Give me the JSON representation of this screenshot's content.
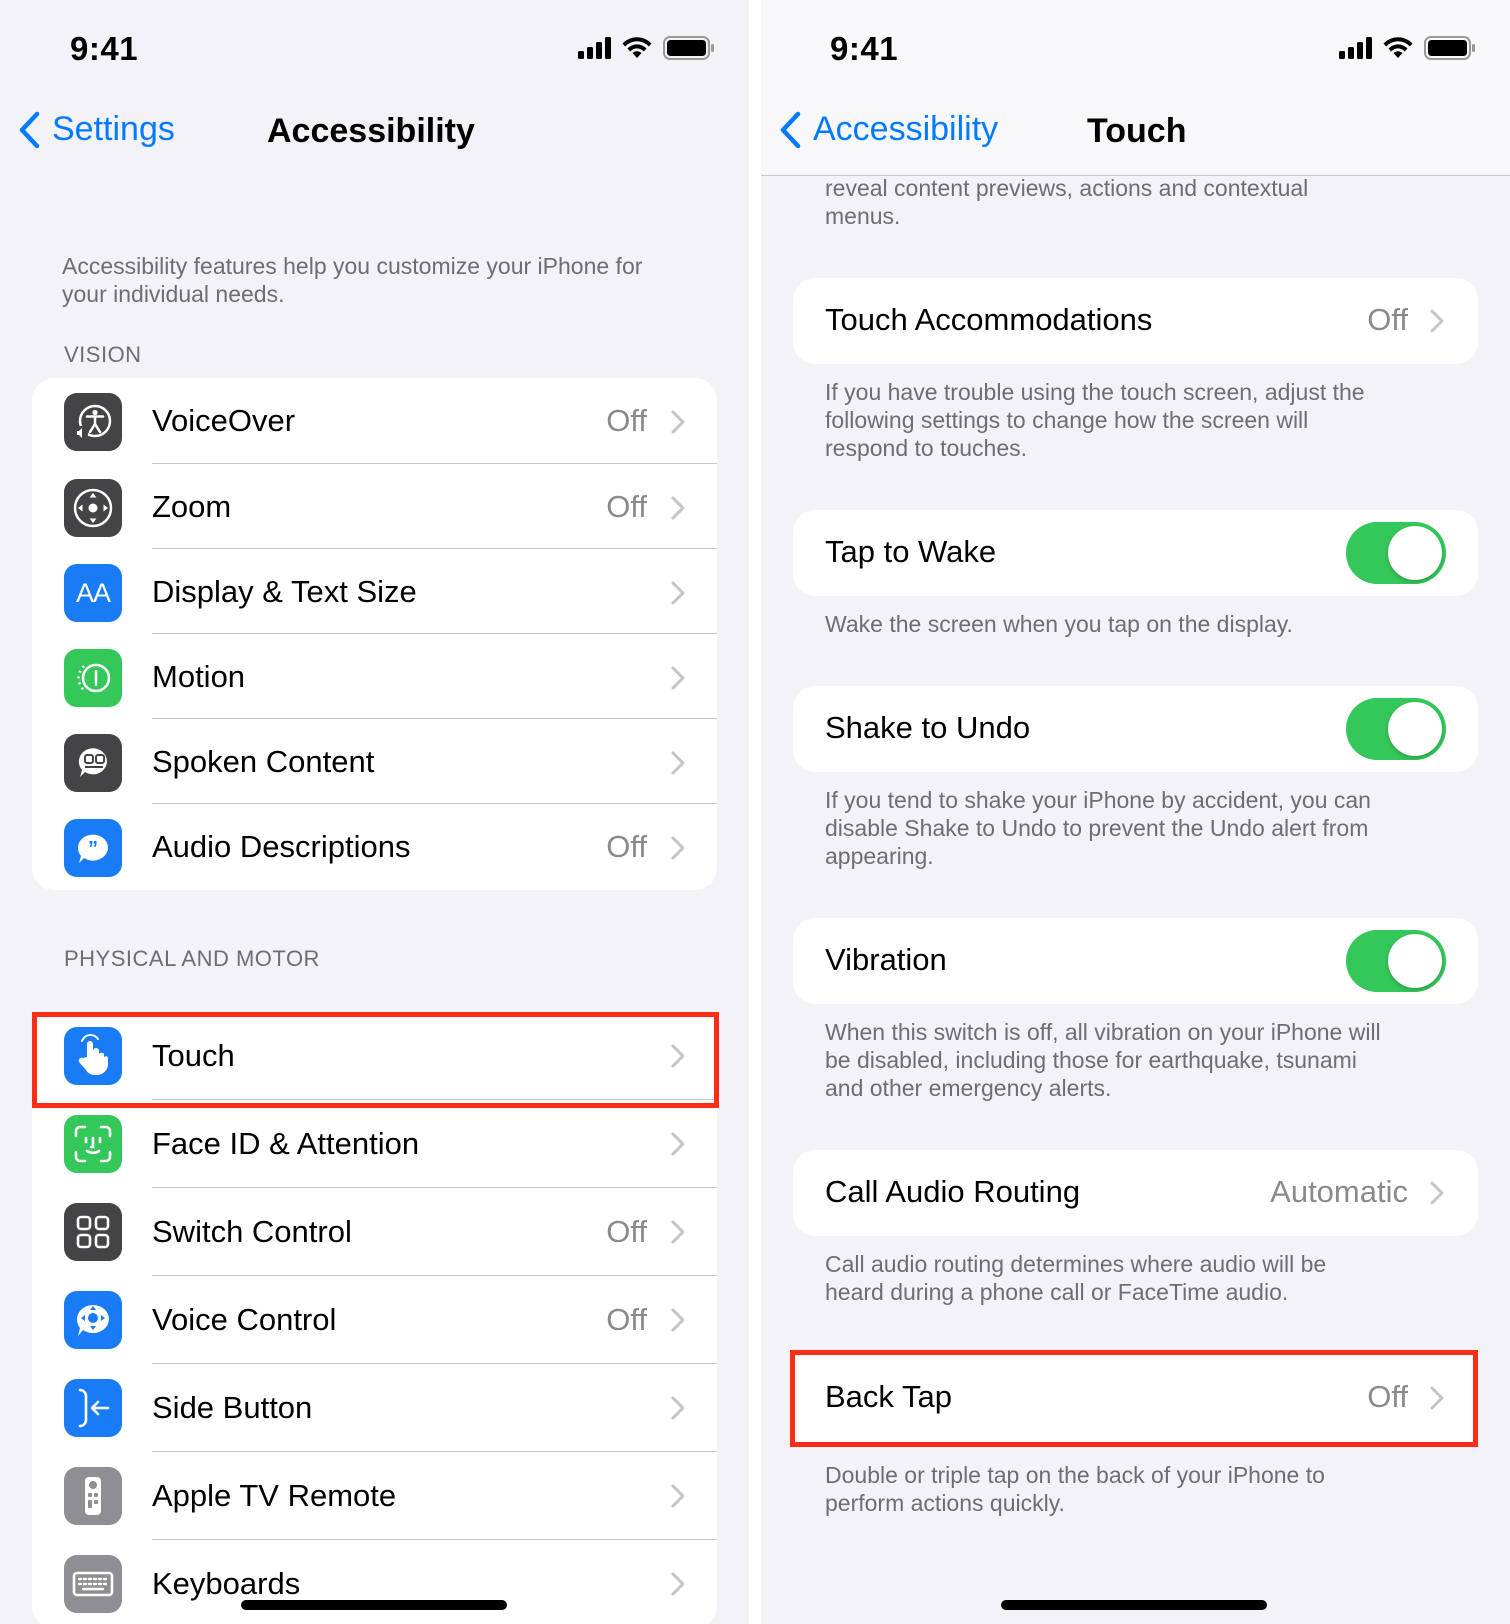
{
  "left": {
    "status": {
      "time": "9:41"
    },
    "nav": {
      "back_label": "Settings",
      "title": "Accessibility"
    },
    "intro": "Accessibility features help you customize your iPhone for your individual needs.",
    "vision_header": "VISION",
    "vision_items": [
      {
        "label": "VoiceOver",
        "value": "Off",
        "icon": "voiceover-icon",
        "color": "#444446"
      },
      {
        "label": "Zoom",
        "value": "Off",
        "icon": "zoom-icon",
        "color": "#444446"
      },
      {
        "label": "Display & Text Size",
        "value": "",
        "icon": "text-size-icon",
        "color": "#1a7cf5"
      },
      {
        "label": "Motion",
        "value": "",
        "icon": "motion-icon",
        "color": "#34c759"
      },
      {
        "label": "Spoken Content",
        "value": "",
        "icon": "spoken-content-icon",
        "color": "#444446"
      },
      {
        "label": "Audio Descriptions",
        "value": "Off",
        "icon": "audio-descriptions-icon",
        "color": "#1a7cf5"
      }
    ],
    "physical_header": "PHYSICAL AND MOTOR",
    "physical_items": [
      {
        "label": "Touch",
        "value": "",
        "icon": "touch-hand-icon",
        "color": "#1a7cf5"
      },
      {
        "label": "Face ID & Attention",
        "value": "",
        "icon": "face-id-icon",
        "color": "#34c759"
      },
      {
        "label": "Switch Control",
        "value": "Off",
        "icon": "switch-control-icon",
        "color": "#444446"
      },
      {
        "label": "Voice Control",
        "value": "Off",
        "icon": "voice-control-icon",
        "color": "#1a7cf5"
      },
      {
        "label": "Side Button",
        "value": "",
        "icon": "side-button-icon",
        "color": "#1a7cf5"
      },
      {
        "label": "Apple TV Remote",
        "value": "",
        "icon": "tv-remote-icon",
        "color": "#8e8e93"
      },
      {
        "label": "Keyboards",
        "value": "",
        "icon": "keyboard-icon",
        "color": "#8e8e93"
      }
    ]
  },
  "right": {
    "status": {
      "time": "9:41"
    },
    "nav": {
      "back_label": "Accessibility",
      "title": "Touch"
    },
    "top_note": "reveal content previews, actions and contextual menus.",
    "rows": [
      {
        "label": "Touch Accommodations",
        "value": "Off",
        "kind": "link",
        "note": "If you have trouble using the touch screen, adjust the following settings to change how the screen will respond to touches."
      },
      {
        "label": "Tap to Wake",
        "value": "",
        "kind": "toggle",
        "on": true,
        "note": "Wake the screen when you tap on the display."
      },
      {
        "label": "Shake to Undo",
        "value": "",
        "kind": "toggle",
        "on": true,
        "note": "If you tend to shake your iPhone by accident, you can disable Shake to Undo to prevent the Undo alert from appearing."
      },
      {
        "label": "Vibration",
        "value": "",
        "kind": "toggle",
        "on": true,
        "note": "When this switch is off, all vibration on your iPhone will be disabled, including those for earthquake, tsunami and other emergency alerts."
      },
      {
        "label": "Call Audio Routing",
        "value": "Automatic",
        "kind": "link",
        "note": "Call audio routing determines where audio will be heard during a phone call or FaceTime audio."
      },
      {
        "label": "Back Tap",
        "value": "Off",
        "kind": "link",
        "note": "Double or triple tap on the back of your iPhone to perform actions quickly."
      }
    ]
  },
  "colors": {
    "accent": "#007aff",
    "toggle_on": "#34c759",
    "highlight": "#ff2d16"
  }
}
